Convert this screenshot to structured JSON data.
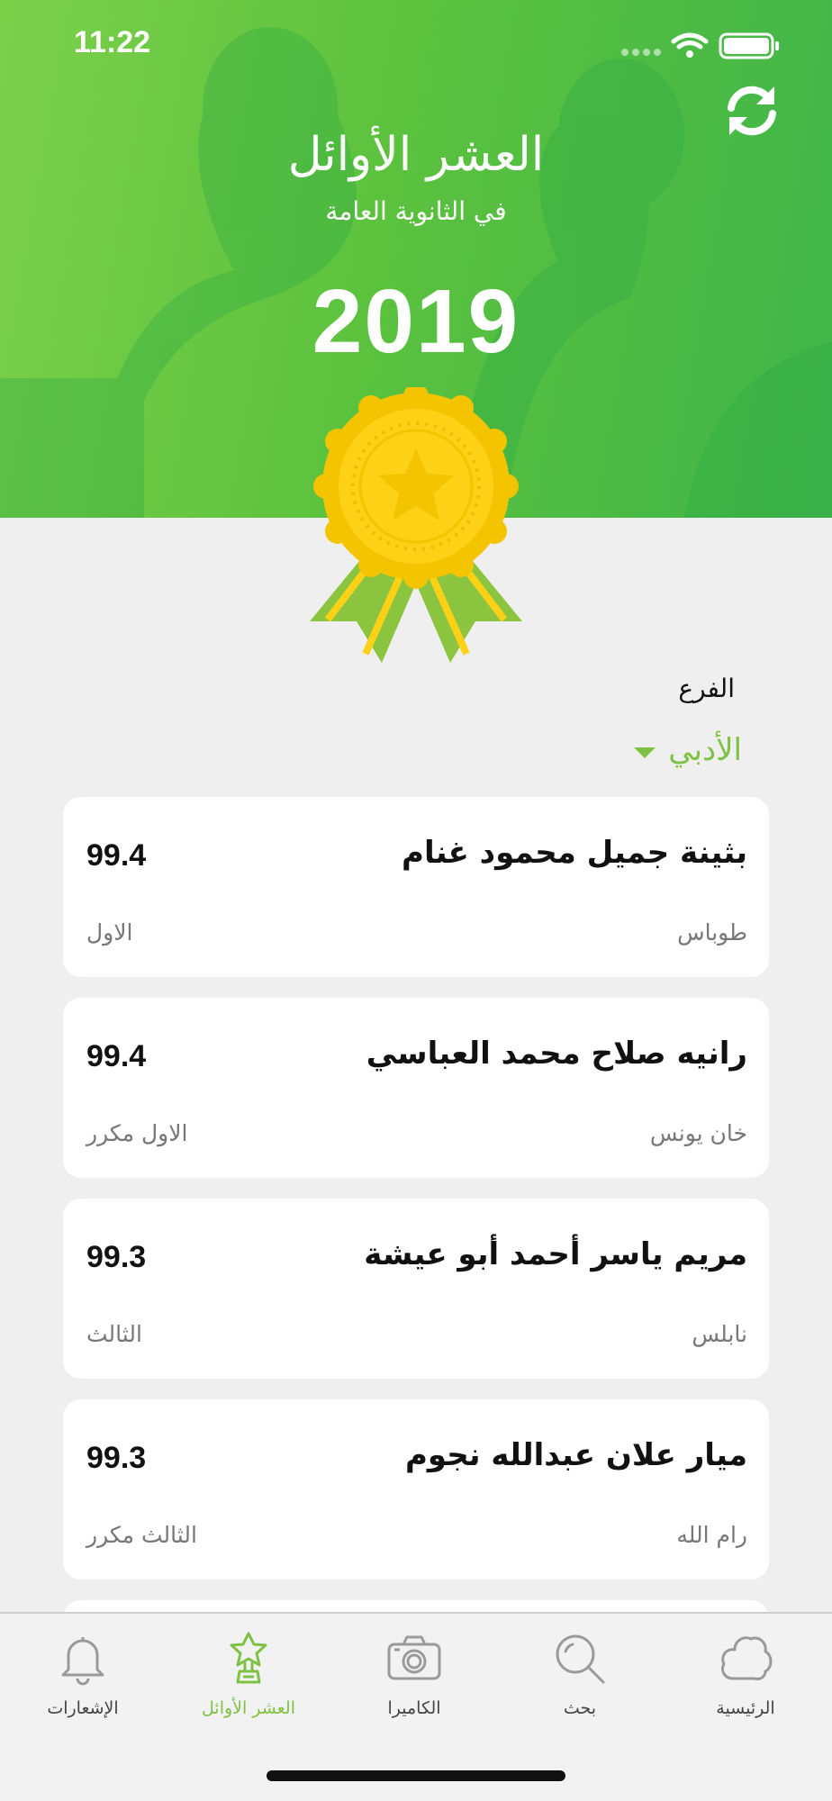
{
  "status": {
    "time": "11:22"
  },
  "hero": {
    "title": "العشر الأوائل",
    "subtitle": "في الثانوية العامة",
    "year": "2019"
  },
  "filter": {
    "label": "الفرع",
    "selected": "الأدبي"
  },
  "students": [
    {
      "name": "بثينة جميل محمود غنام",
      "score": "99.4",
      "city": "طوباس",
      "rank": "الاول"
    },
    {
      "name": "رانيه صلاح محمد العباسي",
      "score": "99.4",
      "city": "خان يونس",
      "rank": "الاول مكرر"
    },
    {
      "name": "مريم ياسر أحمد أبو عيشة",
      "score": "99.3",
      "city": "نابلس",
      "rank": "الثالث"
    },
    {
      "name": "ميار علان عبدالله نجوم",
      "score": "99.3",
      "city": "رام الله",
      "rank": "الثالث مكرر"
    }
  ],
  "tabs": [
    {
      "label": "الإشعارات",
      "icon": "bell-icon"
    },
    {
      "label": "العشر الأوائل",
      "icon": "trophy-star-icon"
    },
    {
      "label": "الكاميرا",
      "icon": "camera-icon"
    },
    {
      "label": "بحث",
      "icon": "search-icon"
    },
    {
      "label": "الرئيسية",
      "icon": "home-cloud-icon"
    }
  ],
  "colors": {
    "accent": "#7dc242",
    "hero_green": "#5cc23e",
    "medal_gold": "#fcd116",
    "background": "#efefef"
  }
}
